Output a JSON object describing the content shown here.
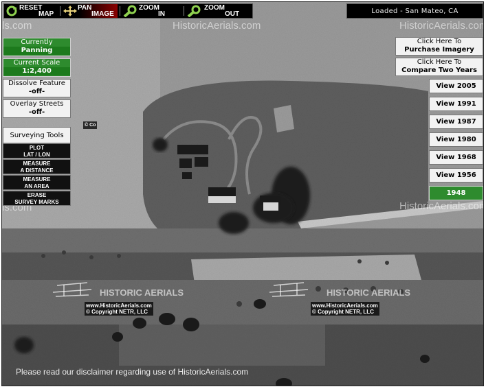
{
  "toolbar": {
    "reset": [
      "RESET",
      "MAP"
    ],
    "pan": [
      "PAN",
      "IMAGE"
    ],
    "zoom_in": [
      "ZOOM",
      "IN"
    ],
    "zoom_out": [
      "ZOOM",
      "OUT"
    ]
  },
  "status": "Loaded - San Mateo, CA",
  "left_panel": {
    "mode_title": "Currently",
    "mode_value": "Panning",
    "scale_title": "Current Scale",
    "scale_value": "1:2,400",
    "dissolve_title": "Dissolve Feature",
    "dissolve_value": "-off-",
    "overlay_title": "Overlay Streets",
    "overlay_value": "-off-",
    "surveying_title": "Surveying Tools",
    "tools": [
      [
        "PLOT",
        "LAT / LON"
      ],
      [
        "MEASURE",
        "A DISTANCE"
      ],
      [
        "MEASURE",
        "AN AREA"
      ],
      [
        "ERASE",
        "SURVEY MARKS"
      ]
    ]
  },
  "right_panel": {
    "purchase": [
      "Click Here To",
      "Purchase Imagery"
    ],
    "compare": [
      "Click Here To",
      "Compare Two Years"
    ],
    "years": [
      "View 2005",
      "View 1991",
      "View 1987",
      "View 1980",
      "View 1968",
      "View 1956",
      "1948"
    ],
    "active_year_index": 6
  },
  "watermarks": {
    "site": "HistoricAerials.com",
    "brand": "HISTORIC AERIALS",
    "url": "www.HistoricAerials.com",
    "copyright": "© Copyright NETR, LLC",
    "partial_left": "ls.com",
    "partial_left_cut": "© Co",
    "partial_right": "HistoricAerials.com"
  },
  "disclaimer": "Please read our disclaimer regarding use of HistoricAerials.com",
  "colors": {
    "active_green": "#2e8b2e",
    "toolbar_bg": "#000000",
    "status_text": "#eeeeee"
  }
}
